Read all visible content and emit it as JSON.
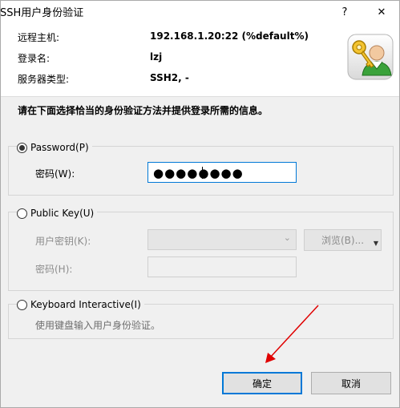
{
  "window": {
    "title": "SSH用户身份验证",
    "help_button": "?",
    "close_button": "✕"
  },
  "info": {
    "host_label": "远程主机:",
    "host_value": "192.168.1.20:22 (%default%)",
    "login_label": "登录名:",
    "login_value": "lzj",
    "server_type_label": "服务器类型:",
    "server_type_value": "SSH2, -"
  },
  "instruction": "请在下面选择恰当的身份验证方法并提供登录所需的信息。",
  "password_group": {
    "radio_label": "Password(P)",
    "selected": true,
    "field_label": "密码(W):",
    "field_value": "●●●●●●●●"
  },
  "public_key_group": {
    "radio_label": "Public Key(U)",
    "selected": false,
    "user_key_label": "用户密钥(K):",
    "user_key_value": "",
    "browse_button": "浏览(B)...",
    "passphrase_label": "密码(H):",
    "passphrase_value": ""
  },
  "keyboard_group": {
    "radio_label": "Keyboard Interactive(I)",
    "selected": false,
    "description": "使用键盘输入用户身份验证。"
  },
  "buttons": {
    "ok": "确定",
    "cancel": "取消"
  },
  "colors": {
    "accent": "#0078d7",
    "annotation_arrow": "#e00000"
  }
}
